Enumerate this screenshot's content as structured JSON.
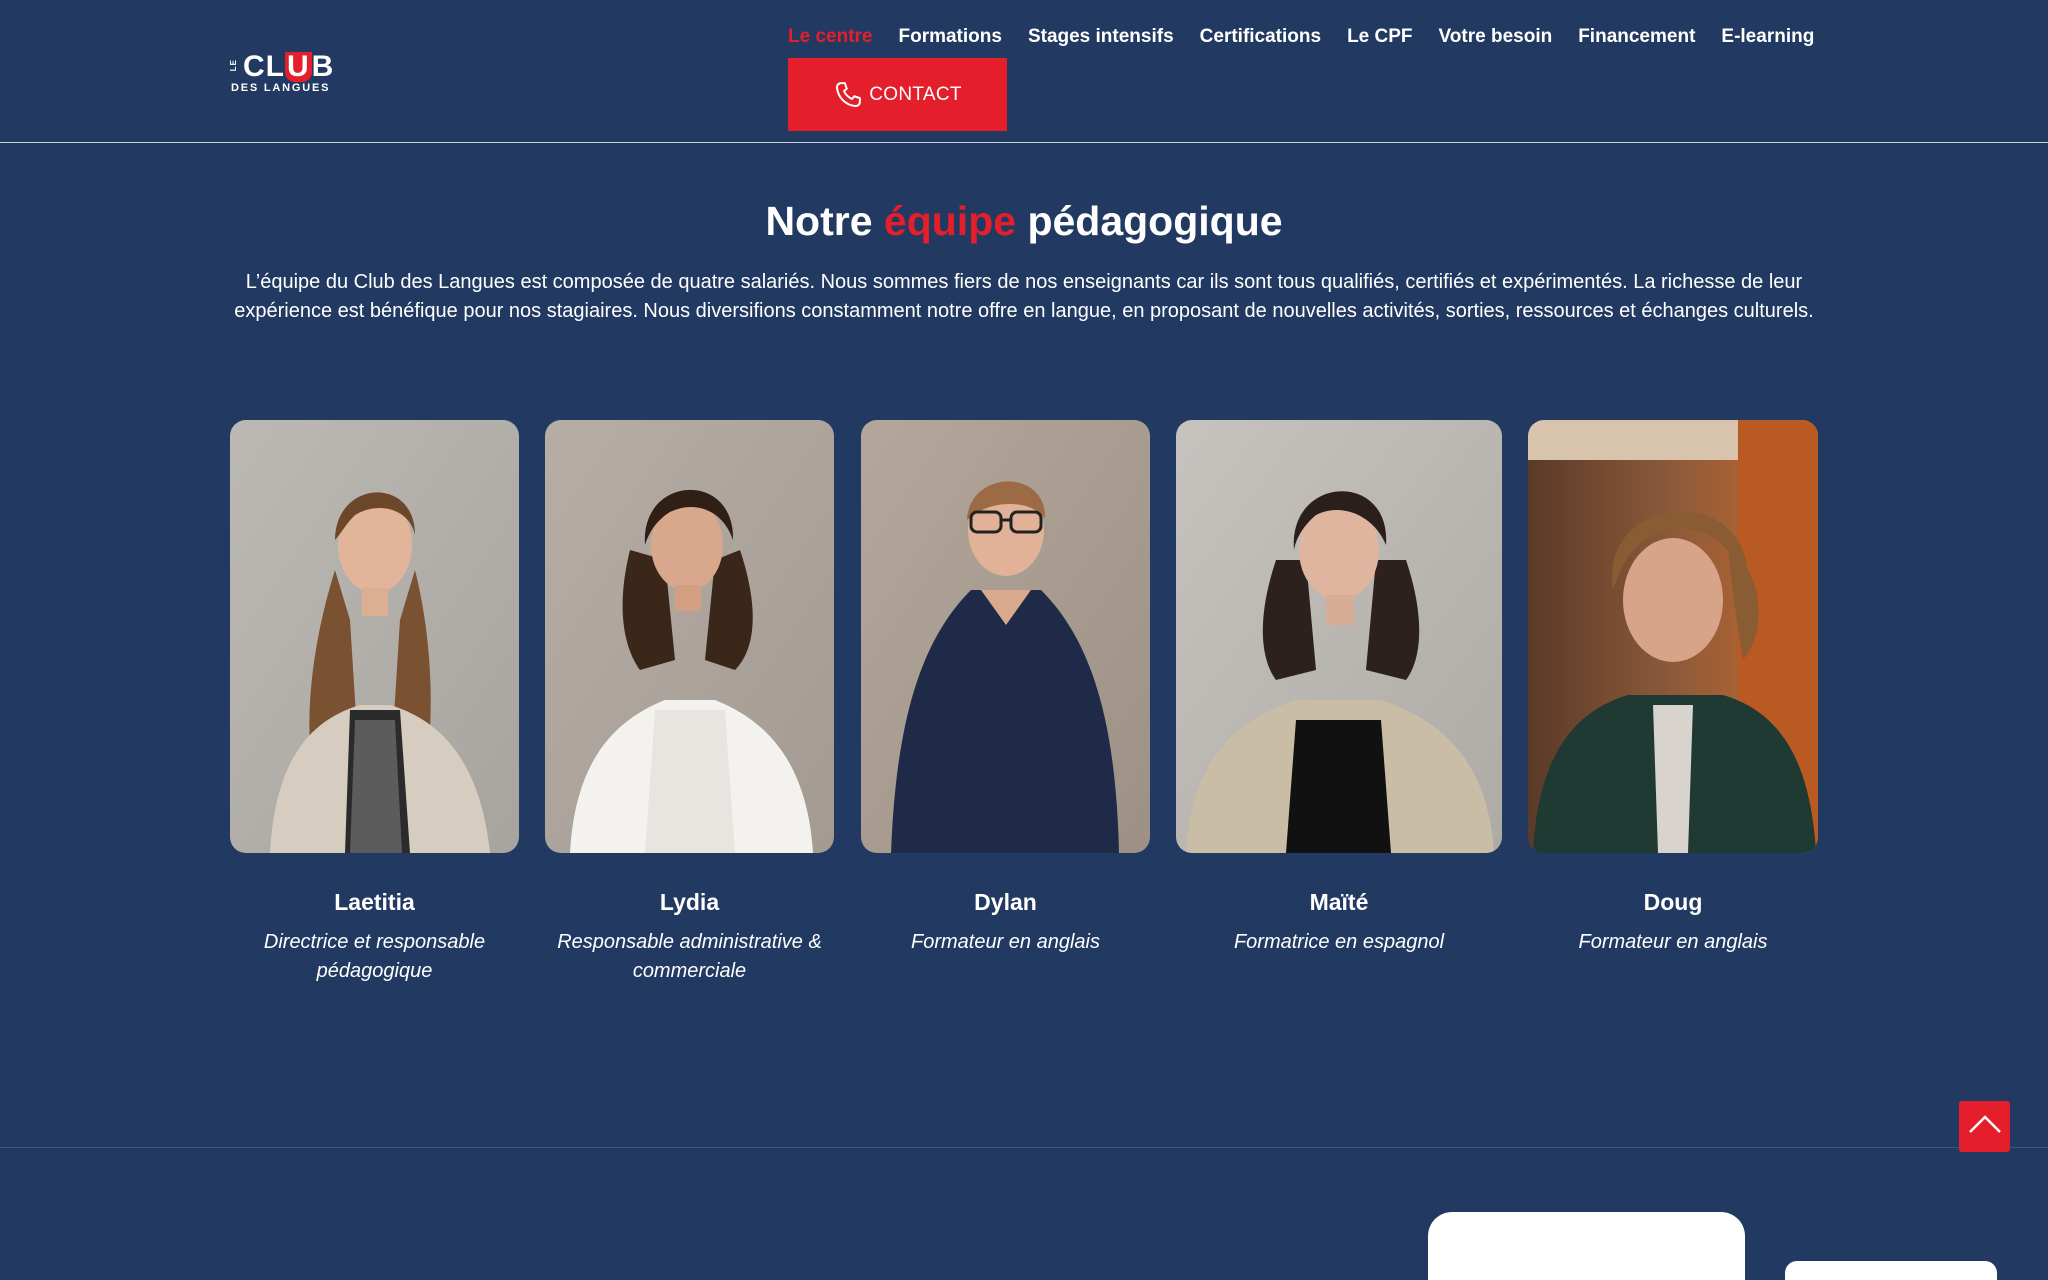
{
  "header": {
    "logo": {
      "le": "LE",
      "club_before": "CL",
      "club_u": "U",
      "club_after": "B",
      "subtitle": "DES LANGUES"
    },
    "nav": [
      {
        "label": "Le centre",
        "active": true
      },
      {
        "label": "Formations",
        "active": false
      },
      {
        "label": "Stages intensifs",
        "active": false
      },
      {
        "label": "Certifications",
        "active": false
      },
      {
        "label": "Le CPF",
        "active": false
      },
      {
        "label": "Votre besoin",
        "active": false
      },
      {
        "label": "Financement",
        "active": false
      },
      {
        "label": "E-learning",
        "active": false
      }
    ],
    "contact_label": "CONTACT",
    "contact_icon": "phone-icon"
  },
  "section": {
    "title_before": "Notre ",
    "title_accent": "équipe",
    "title_after": " pédagogique",
    "intro": "L’équipe du Club des Langues est composée de quatre salariés. Nous sommes fiers de nos enseignants car ils sont tous qualifiés, certifiés et expérimentés. La richesse de leur expérience est bénéfique pour nos stagiaires. Nous diversifions constamment notre offre en langue, en proposant de nouvelles activités, sorties, ressources et échanges culturels."
  },
  "team": [
    {
      "name": "Laetitia",
      "role": "Directrice et responsable pédagogique"
    },
    {
      "name": "Lydia",
      "role": "Responsable administrative & commerciale"
    },
    {
      "name": "Dylan",
      "role": "Formateur en anglais"
    },
    {
      "name": "Maïté",
      "role": "Formatrice en espagnol"
    },
    {
      "name": "Doug",
      "role": "Formateur en anglais"
    }
  ],
  "scroll_top_icon": "chevron-up-icon",
  "colors": {
    "background": "#223a62",
    "accent": "#e41e2b",
    "text": "#ffffff"
  }
}
